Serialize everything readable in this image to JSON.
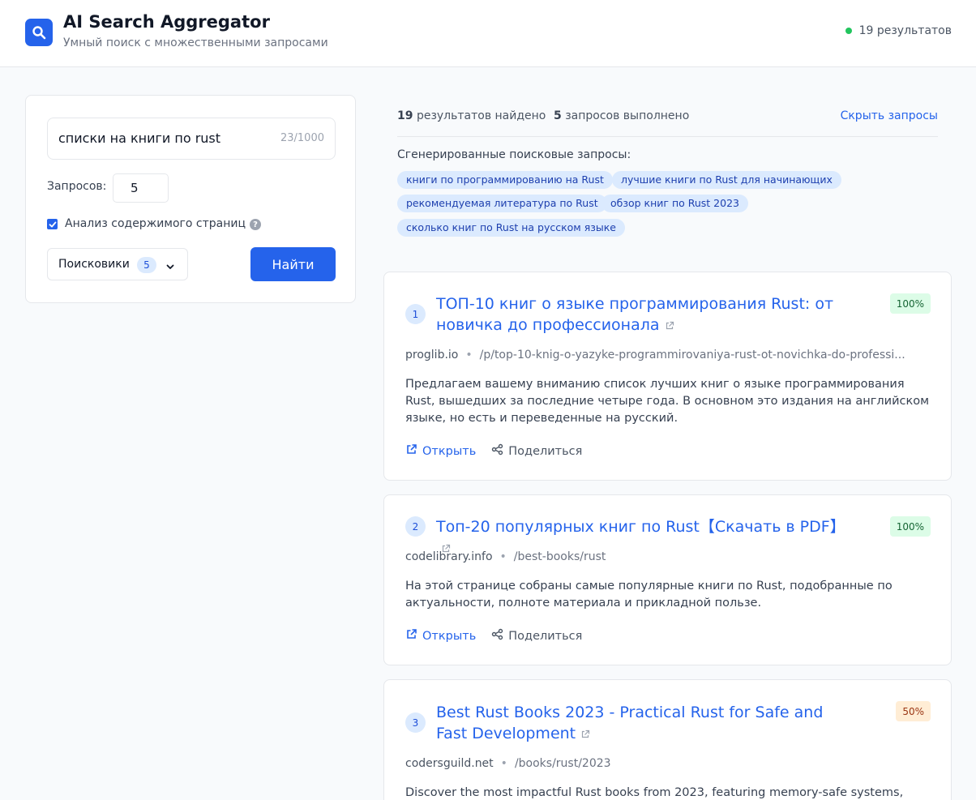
{
  "app": {
    "title": "AI Search Aggregator",
    "subtitle": "Умный поиск с множественными запросами",
    "status_text": "19 результатов",
    "status_color": "#22c55e",
    "accent": "#2563eb"
  },
  "search": {
    "query": "списки на книги по rust",
    "char_count": "23/1000",
    "count_label": "Запросов:",
    "count_value": "5",
    "analyze_checked": true,
    "analyze_label": "Анализ содержимого страниц",
    "help_icon": "?",
    "engines_label": "Поисковики",
    "engines_count": "5",
    "submit_label": "Найти"
  },
  "summary": {
    "results_count": "19",
    "results_label": "результатов найдено",
    "queries_count": "5",
    "queries_label": "запросов выполнено",
    "hide_label": "Скрыть запросы",
    "generated_title": "Сгенерированные поисковые запросы:",
    "generated_queries": [
      "книги по программированию на Rust",
      "лучшие книги по Rust для начинающих",
      "рекомендуемая литература по Rust",
      "обзор книг по Rust 2023",
      "сколько книг по Rust на русском языке"
    ]
  },
  "results": [
    {
      "rank": "1",
      "title": "ТОП-10 книг о языке программирования Rust: от новичка до профессионала",
      "score": "100%",
      "domain": "proglib.io",
      "separator": "•",
      "path": "/p/top-10-knig-o-yazyke-programmirovaniya-rust-ot-novichka-do-professi...",
      "snippet": "Предлагаем вашему вниманию список лучших книг о языке программирования Rust, вышедших за последние четыре года. В основном это издания на английском языке, но есть и переведенные на русский.",
      "open_label": "Открыть",
      "share_label": "Поделиться"
    },
    {
      "rank": "2",
      "title": "Топ-20 популярных книг по Rust【Скачать в PDF】",
      "score": "100%",
      "domain": "codelibrary.info",
      "separator": "•",
      "path": "/best-books/rust",
      "snippet": "На этой странице собраны самые популярные книги по Rust, подобранные по актуальности, полноте материала и прикладной пользе.",
      "open_label": "Открыть",
      "share_label": "Поделиться"
    },
    {
      "rank": "3",
      "title": "Best Rust Books 2023 - Practical Rust for Safe and Fast Development",
      "score": "50%",
      "domain": "codersguild.net",
      "separator": "•",
      "path": "/books/rust/2023",
      "snippet": "Discover the most impactful Rust books from 2023, featuring memory-safe systems,"
    }
  ]
}
